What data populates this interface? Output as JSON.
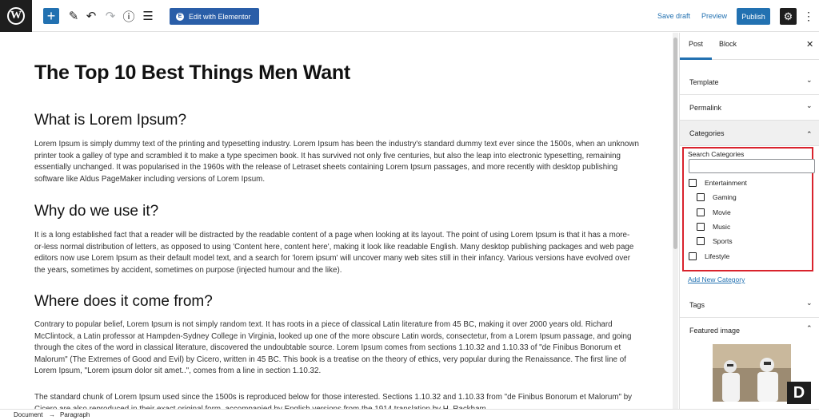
{
  "toolbar": {
    "logo_letter": "W",
    "add_icon": "+",
    "edit_icon": "✎",
    "undo_icon": "↶",
    "redo_icon": "↷",
    "info_icon": "ⓘ",
    "outline_icon": "☰",
    "elementor_label": "Edit with Elementor",
    "save_draft": "Save draft",
    "preview": "Preview",
    "publish": "Publish",
    "settings_icon": "⚙",
    "more_icon": "⋮"
  },
  "editor": {
    "title": "The Top 10 Best Things Men Want",
    "sections": [
      {
        "heading": "What is Lorem Ipsum?",
        "paragraph": "Lorem Ipsum is simply dummy text of the printing and typesetting industry. Lorem Ipsum has been the industry's standard dummy text ever since the 1500s, when an unknown printer took a galley of type and scrambled it to make a type specimen book. It has survived not only five centuries, but also the leap into electronic typesetting, remaining essentially unchanged. It was popularised in the 1960s with the release of Letraset sheets containing Lorem Ipsum passages, and more recently with desktop publishing software like Aldus PageMaker including versions of Lorem Ipsum."
      },
      {
        "heading": "Why do we use it?",
        "paragraph": "It is a long established fact that a reader will be distracted by the readable content of a page when looking at its layout. The point of using Lorem Ipsum is that it has a more-or-less normal distribution of letters, as opposed to using 'Content here, content here', making it look like readable English. Many desktop publishing packages and web page editors now use Lorem Ipsum as their default model text, and a search for 'lorem ipsum' will uncover many web sites still in their infancy. Various versions have evolved over the years, sometimes by accident, sometimes on purpose (injected humour and the like)."
      },
      {
        "heading": "Where does it come from?",
        "paragraph": "Contrary to popular belief, Lorem Ipsum is not simply random text. It has roots in a piece of classical Latin literature from 45 BC, making it over 2000 years old. Richard McClintock, a Latin professor at Hampden-Sydney College in Virginia, looked up one of the more obscure Latin words, consectetur, from a Lorem Ipsum passage, and going through the cites of the word in classical literature, discovered the undoubtable source. Lorem Ipsum comes from sections 1.10.32 and 1.10.33 of \"de Finibus Bonorum et Malorum\" (The Extremes of Good and Evil) by Cicero, written in 45 BC. This book is a treatise on the theory of ethics, very popular during the Renaissance. The first line of Lorem Ipsum, \"Lorem ipsum dolor sit amet..\", comes from a line in section 1.10.32.",
        "paragraph2": "The standard chunk of Lorem Ipsum used since the 1500s is reproduced below for those interested. Sections 1.10.32 and 1.10.33 from \"de Finibus Bonorum et Malorum\" by Cicero are also reproduced in their exact original form, accompanied by English versions from the 1914 translation by H. Rackham."
      }
    ]
  },
  "sidebar": {
    "tabs": [
      "Post",
      "Block"
    ],
    "close_icon": "✕",
    "chevron_down": "⌄",
    "chevron_up": "⌃",
    "panels": {
      "template": "Template",
      "permalink": "Permalink",
      "categories": "Categories",
      "tags": "Tags",
      "featured_image": "Featured image"
    },
    "categories": {
      "search_label": "Search Categories",
      "search_value": "",
      "items": [
        {
          "label": "Entertainment",
          "checked": false,
          "level": 0
        },
        {
          "label": "Gaming",
          "checked": false,
          "level": 1
        },
        {
          "label": "Movie",
          "checked": false,
          "level": 1
        },
        {
          "label": "Music",
          "checked": false,
          "level": 1
        },
        {
          "label": "Sports",
          "checked": false,
          "level": 1
        },
        {
          "label": "Lifestyle",
          "checked": false,
          "level": 0
        }
      ],
      "add_new": "Add New Category"
    },
    "badge_letter": "D"
  },
  "footer": {
    "breadcrumb": [
      "Document",
      "Paragraph"
    ],
    "separator": "→"
  },
  "colors": {
    "accent": "#2271b1",
    "elementor": "#2a5ea8",
    "highlight": "#d9232d",
    "dark": "#1e1e1e"
  }
}
